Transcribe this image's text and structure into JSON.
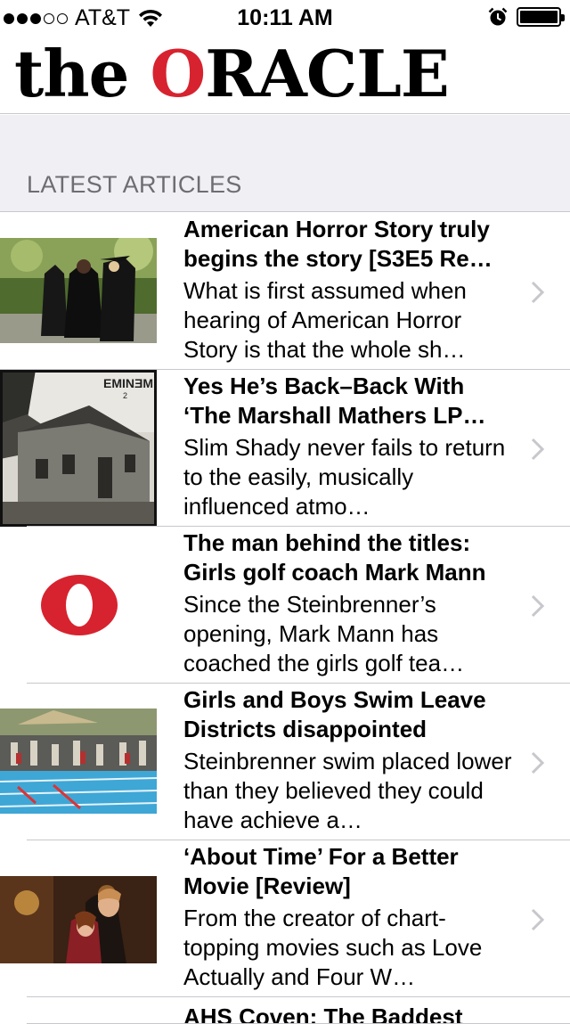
{
  "status_bar": {
    "carrier": "AT&T",
    "signal_bars_filled": 3,
    "signal_bars_total": 5,
    "time": "10:11 AM",
    "battery_level": 1.0
  },
  "header": {
    "logo_the": "the",
    "logo_o": "O",
    "logo_rest": "RACLE",
    "accent_color": "#d7232f"
  },
  "section": {
    "title": "LATEST ARTICLES"
  },
  "articles": [
    {
      "title": "American Horror Story truly begins the story [S3E5 Re…",
      "summary": "What is first assumed when hearing of American Horror Story is that the whole sh…",
      "thumbnail": "ahs-photo"
    },
    {
      "title": "Yes He’s Back–Back With ‘The Marshall Mathers LP…",
      "summary": "Slim Shady never fails to return to the easily, musically influenced atmo…",
      "thumbnail": "eminem-album-cover",
      "thumb_label": "EMINƎM"
    },
    {
      "title": "The man behind the titles: Girls golf coach Mark Mann",
      "summary": "Since the Steinbrenner’s opening, Mark Mann has coached the girls golf tea…",
      "thumbnail": "oracle-o-logo"
    },
    {
      "title": "Girls and Boys Swim Leave Districts disappointed",
      "summary": "Steinbrenner swim placed lower than they believed they could have achieve a…",
      "thumbnail": "swim-meet-photo"
    },
    {
      "title": "‘About Time’ For a Better Movie [Review]",
      "summary": "From the creator of chart-topping movies such as Love Actually and Four W…",
      "thumbnail": "about-time-still"
    },
    {
      "title": "AHS Coven: The Baddest",
      "summary": "",
      "thumbnail": ""
    }
  ]
}
